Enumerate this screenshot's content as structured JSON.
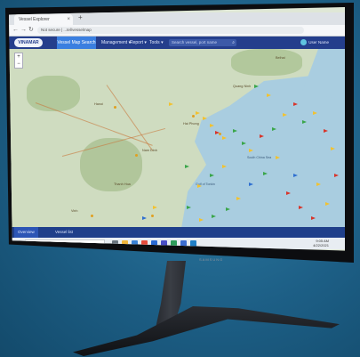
{
  "browser": {
    "tab_title": "Vessel Explorer",
    "url": "Not secure | ...tel/vesselmap"
  },
  "app": {
    "logo_text": "VINAMAR",
    "nav_active": "Vessel Map Search",
    "nav_items": [
      "Management",
      "Report",
      "Tools"
    ],
    "search_placeholder": "Search vessel, port name",
    "user_label": "User Name"
  },
  "map": {
    "regions": [
      "South China Sea",
      "Gulf of Tonkin"
    ],
    "cities": [
      "Hanoi",
      "Hai Phong",
      "Nam Dinh",
      "Thanh Hoa",
      "Vinh",
      "Quang Ninh",
      "Beihai"
    ]
  },
  "bottom_strip": {
    "tabs": [
      "Overview",
      "Vessel list"
    ]
  },
  "taskbar": {
    "search_placeholder": "Type here to search",
    "time": "9:05 AM",
    "date": "4/22/2021"
  },
  "monitor": {
    "brand": "SAMSUNG"
  },
  "colors": {
    "nav_bg": "#243e8c",
    "nav_active": "#3a7fe0",
    "ship_yellow": "#f2c230",
    "ship_green": "#3aa64a",
    "ship_red": "#d8342a",
    "ship_blue": "#2f6fd0",
    "sea": "#a9cde0"
  }
}
